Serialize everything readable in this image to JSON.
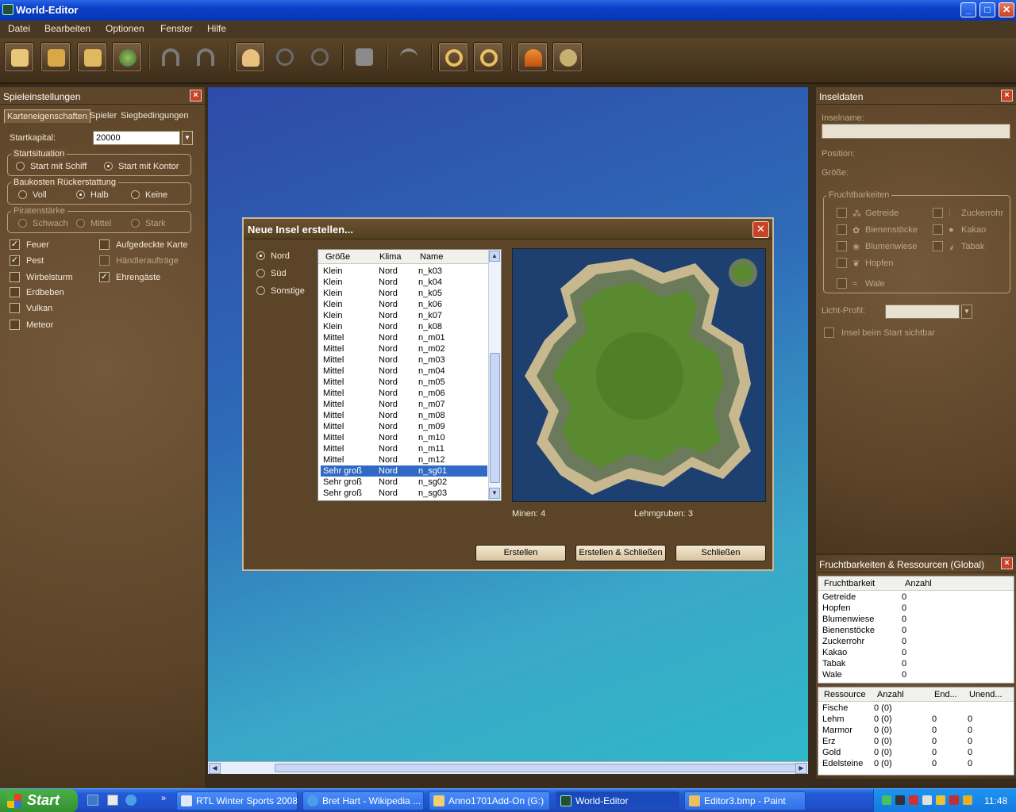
{
  "window": {
    "title": "World-Editor",
    "min": "_",
    "max": "□",
    "close": "✕"
  },
  "menu": [
    "Datei",
    "Bearbeiten",
    "Optionen",
    "Fenster",
    "Hilfe"
  ],
  "left_panel": {
    "title": "Spieleinstellungen",
    "tabs": [
      "Karteneigenschaften",
      "Spieler",
      "Siegbedingungen"
    ],
    "startkapital_label": "Startkapital:",
    "startkapital_value": "20000",
    "startsituation": {
      "label": "Startsituation",
      "options": [
        "Start mit Schiff",
        "Start mit Kontor"
      ],
      "selected": "Start mit Kontor"
    },
    "baukosten": {
      "label": "Baukosten Rückerstattung",
      "options": [
        "Voll",
        "Halb",
        "Keine"
      ],
      "selected": "Halb"
    },
    "piratenstaerke": {
      "label": "Piratenstärke",
      "options": [
        "Schwach",
        "Mittel",
        "Stark"
      ]
    },
    "checks_left": [
      {
        "label": "Feuer",
        "checked": true
      },
      {
        "label": "Pest",
        "checked": true
      },
      {
        "label": "Wirbelsturm",
        "checked": false
      },
      {
        "label": "Erdbeben",
        "checked": false
      },
      {
        "label": "Vulkan",
        "checked": false
      },
      {
        "label": "Meteor",
        "checked": false
      }
    ],
    "checks_right": [
      {
        "label": "Aufgedeckte Karte",
        "checked": false
      },
      {
        "label": "Händleraufträge",
        "checked": false,
        "disabled": true
      },
      {
        "label": "Ehrengäste",
        "checked": true
      }
    ]
  },
  "dialog": {
    "title": "Neue Insel erstellen...",
    "close": "✕",
    "climate_options": [
      "Nord",
      "Süd",
      "Sonstige"
    ],
    "climate_selected": "Nord",
    "columns": [
      "Größe",
      "Klima",
      "Name"
    ],
    "rows": [
      [
        "Klein",
        "Nord",
        "n_k03"
      ],
      [
        "Klein",
        "Nord",
        "n_k04"
      ],
      [
        "Klein",
        "Nord",
        "n_k05"
      ],
      [
        "Klein",
        "Nord",
        "n_k06"
      ],
      [
        "Klein",
        "Nord",
        "n_k07"
      ],
      [
        "Klein",
        "Nord",
        "n_k08"
      ],
      [
        "Mittel",
        "Nord",
        "n_m01"
      ],
      [
        "Mittel",
        "Nord",
        "n_m02"
      ],
      [
        "Mittel",
        "Nord",
        "n_m03"
      ],
      [
        "Mittel",
        "Nord",
        "n_m04"
      ],
      [
        "Mittel",
        "Nord",
        "n_m05"
      ],
      [
        "Mittel",
        "Nord",
        "n_m06"
      ],
      [
        "Mittel",
        "Nord",
        "n_m07"
      ],
      [
        "Mittel",
        "Nord",
        "n_m08"
      ],
      [
        "Mittel",
        "Nord",
        "n_m09"
      ],
      [
        "Mittel",
        "Nord",
        "n_m10"
      ],
      [
        "Mittel",
        "Nord",
        "n_m11"
      ],
      [
        "Mittel",
        "Nord",
        "n_m12"
      ],
      [
        "Sehr groß",
        "Nord",
        "n_sg01"
      ],
      [
        "Sehr groß",
        "Nord",
        "n_sg02"
      ],
      [
        "Sehr groß",
        "Nord",
        "n_sg03"
      ]
    ],
    "selected_index": 18,
    "minen": "Minen: 4",
    "lehmgruben": "Lehmgruben: 3",
    "buttons": [
      "Erstellen",
      "Erstellen & Schließen",
      "Schließen"
    ]
  },
  "right_panel": {
    "title": "Inseldaten",
    "inselname_label": "Inselname:",
    "position_label": "Position:",
    "groesse_label": "Größe:",
    "fruchtbarkeiten_label": "Fruchtbarkeiten",
    "fruits_left": [
      "Getreide",
      "Bienenstöcke",
      "Blumenwiese",
      "Hopfen",
      "Wale"
    ],
    "fruits_right": [
      "Zuckerrohr",
      "Kakao",
      "Tabak"
    ],
    "licht_label": "Licht-Profil:",
    "sichtbar_label": "Insel beim Start sichtbar"
  },
  "global_panel": {
    "title": "Fruchtbarkeiten & Ressourcen (Global)",
    "fruit_cols": [
      "Fruchtbarkeit",
      "Anzahl"
    ],
    "fruits": [
      [
        "Getreide",
        "0"
      ],
      [
        "Hopfen",
        "0"
      ],
      [
        "Blumenwiese",
        "0"
      ],
      [
        "Bienenstöcke",
        "0"
      ],
      [
        "Zuckerrohr",
        "0"
      ],
      [
        "Kakao",
        "0"
      ],
      [
        "Tabak",
        "0"
      ],
      [
        "Wale",
        "0"
      ]
    ],
    "res_cols": [
      "Ressource",
      "Anzahl",
      "End...",
      "Unend..."
    ],
    "resources": [
      [
        "Fische",
        "0 (0)",
        "",
        ""
      ],
      [
        "Lehm",
        "0 (0)",
        "0",
        "0"
      ],
      [
        "Marmor",
        "0 (0)",
        "0",
        "0"
      ],
      [
        "Erz",
        "0 (0)",
        "0",
        "0"
      ],
      [
        "Gold",
        "0 (0)",
        "0",
        "0"
      ],
      [
        "Edelsteine",
        "0 (0)",
        "0",
        "0"
      ]
    ]
  },
  "taskbar": {
    "start": "Start",
    "tasks": [
      "RTL Winter Sports 2008",
      "Bret Hart - Wikipedia ...",
      "Anno1701Add-On (G:)",
      "World-Editor",
      "Editor3.bmp - Paint"
    ],
    "active": "World-Editor",
    "clock": "11:48"
  },
  "colors": {
    "accent": "#316ac5",
    "panel": "#6a5030",
    "titlebar": "#0a3fc8"
  }
}
